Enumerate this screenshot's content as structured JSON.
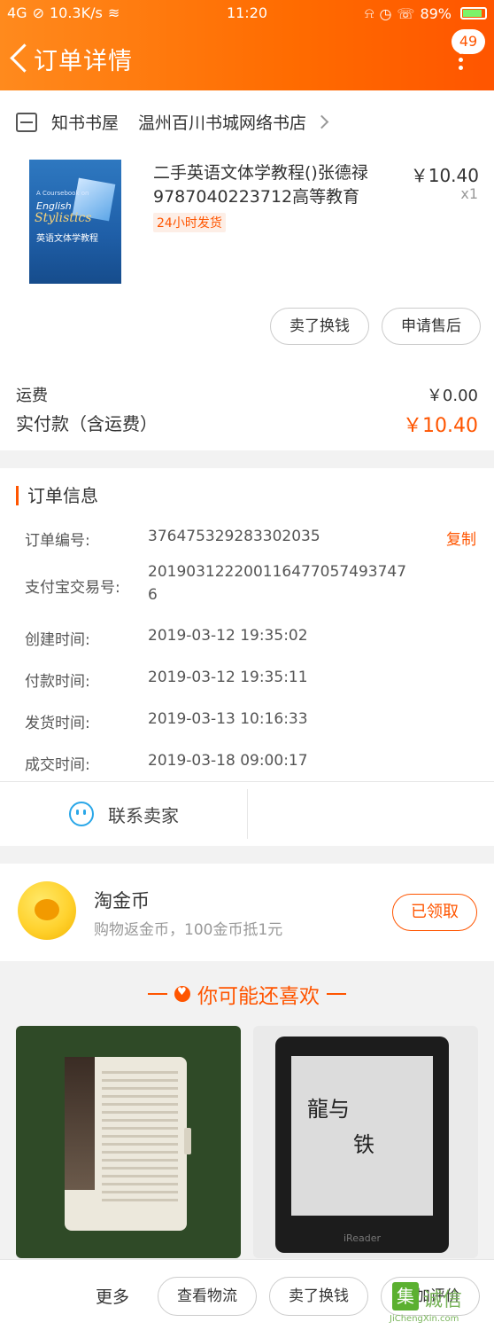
{
  "status_bar": {
    "network_type": "4G",
    "speed": "10.3K/s",
    "time": "11:20",
    "battery": "89%"
  },
  "header": {
    "title": "订单详情",
    "badge_count": "49",
    "accent_color": "#ff6b00"
  },
  "shop": {
    "platform_name": "知书书屋",
    "store_name": "温州百川书城网络书店"
  },
  "item": {
    "title": "二手英语文体学教程()张德禄9787040223712高等教育",
    "delivery_tag": "24小时发货",
    "price": "￥10.40",
    "quantity": "x1",
    "cover_text": {
      "line1": "A Coursebook on",
      "line2": "English",
      "line3": "Stylistics",
      "line4": "英语文体学教程"
    },
    "actions": {
      "sell_label": "卖了换钱",
      "after_sale_label": "申请售后"
    }
  },
  "fees": {
    "shipping_label": "运费",
    "shipping_value": "￥0.00",
    "paid_label": "实付款（含运费）",
    "paid_value": "￥10.40"
  },
  "order_info": {
    "title": "订单信息",
    "copy_label": "复制",
    "rows": [
      {
        "label": "订单编号:",
        "value": "376475329283302035"
      },
      {
        "label": "支付宝交易号:",
        "value": "2019031222001164770574937476"
      },
      {
        "label": "创建时间:",
        "value": "2019-03-12 19:35:02"
      },
      {
        "label": "付款时间:",
        "value": "2019-03-12 19:35:11"
      },
      {
        "label": "发货时间:",
        "value": "2019-03-13 10:16:33"
      },
      {
        "label": "成交时间:",
        "value": "2019-03-18 09:00:17"
      }
    ],
    "contact_label": "联系卖家"
  },
  "coins": {
    "title": "淘金币",
    "subtitle": "购物返金币，100金币抵1元",
    "button_label": "已领取"
  },
  "recommend": {
    "title": "你可能还喜欢",
    "product_1_caption": "Kindle case",
    "product_2_brand": "iReader"
  },
  "bottom_bar": {
    "more_label": "更多",
    "logistics_label": "查看物流",
    "sell_label": "卖了换钱",
    "review_label": "追加评价"
  },
  "watermark": {
    "char": "集",
    "text": "诚信",
    "url": "JiChengXin.com"
  }
}
